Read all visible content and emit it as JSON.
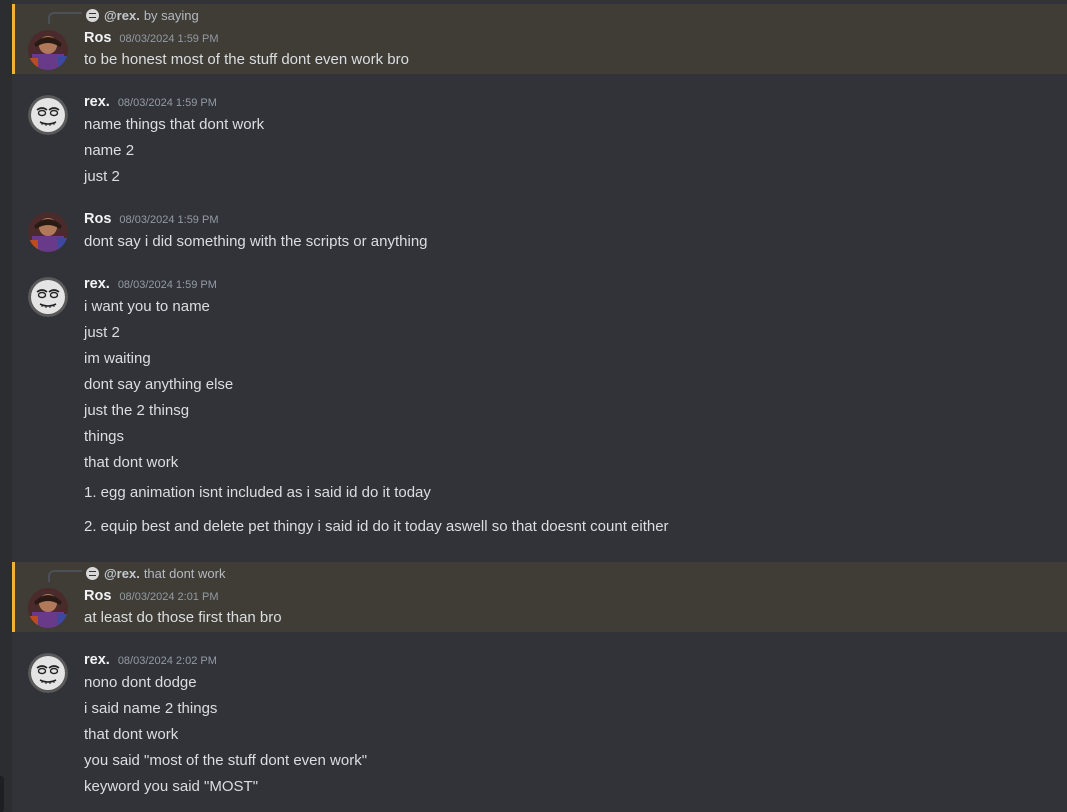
{
  "messages": [
    {
      "reply": {
        "name": "@rex.",
        "text": "by saying"
      },
      "author": "Ros",
      "timestamp": "08/03/2024 1:59 PM",
      "lines": [
        "to be honest most of the stuff dont even work bro"
      ]
    },
    {
      "author": "rex.",
      "timestamp": "08/03/2024 1:59 PM",
      "lines": [
        "name things that dont work",
        "name 2",
        "just 2"
      ]
    },
    {
      "author": "Ros",
      "timestamp": "08/03/2024 1:59 PM",
      "lines": [
        "dont say i did something with the scripts or anything"
      ]
    },
    {
      "author": "rex.",
      "timestamp": "08/03/2024 1:59 PM",
      "lines": [
        "i want you to name",
        "just 2",
        "im waiting",
        "dont say anything else",
        "just the 2 thinsg",
        "things",
        "that dont work",
        "1. egg animation isnt included as i said id do it today",
        "2. equip best and delete pet thingy i said id do it today aswell so that doesnt count either"
      ]
    },
    {
      "reply": {
        "name": "@rex.",
        "text": "that dont work"
      },
      "author": "Ros",
      "timestamp": "08/03/2024 2:01 PM",
      "lines": [
        "at least do those first than bro"
      ]
    },
    {
      "author": "rex.",
      "timestamp": "08/03/2024 2:02 PM",
      "lines": [
        "nono dont dodge",
        "i said name 2 things",
        "that dont work",
        "you said \"most of the stuff dont even work\"",
        "keyword you said \"MOST\""
      ]
    }
  ]
}
